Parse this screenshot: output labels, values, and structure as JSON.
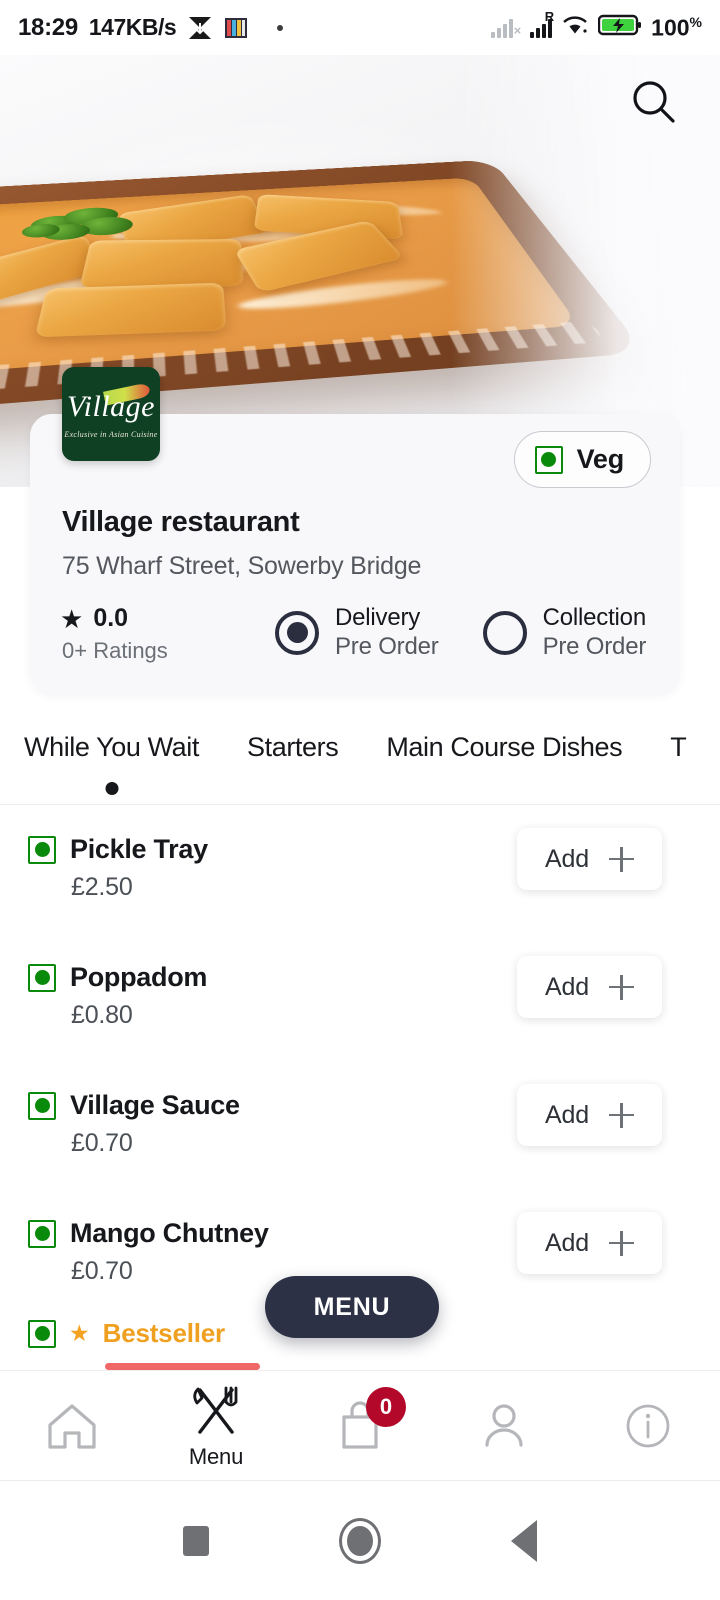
{
  "status_bar": {
    "time": "18:29",
    "network_speed": "147KB/s",
    "battery_percent": "100",
    "battery_percent_symbol": "%",
    "roaming_label": "R",
    "icons": [
      "download-arrow-icon",
      "colorful-app-icon",
      "notification-dot-icon",
      "signal-weak-icon",
      "signal-icon",
      "wifi-icon",
      "battery-charging-icon"
    ]
  },
  "header": {
    "search_icon": "search-icon",
    "hero_image_alt": "curry-dish-photo"
  },
  "restaurant": {
    "logo_name": "Village",
    "logo_tagline": "Exclusive in Asian Cuisine",
    "veg_badge": "Veg",
    "name": "Village restaurant",
    "address": "75 Wharf Street, Sowerby Bridge",
    "rating_value": "0.0",
    "rating_count": "0+ Ratings",
    "star_glyph": "★",
    "order_options": [
      {
        "label": "Delivery",
        "sub": "Pre Order",
        "selected": true
      },
      {
        "label": "Collection",
        "sub": "Pre Order",
        "selected": false
      }
    ]
  },
  "category_tabs": {
    "active_index": 0,
    "items": [
      {
        "label": "While You Wait"
      },
      {
        "label": "Starters"
      },
      {
        "label": "Main Course Dishes"
      },
      {
        "label": "T"
      }
    ]
  },
  "menu_items": [
    {
      "name": "Pickle Tray",
      "price": "£2.50",
      "veg": true,
      "add_label": "Add"
    },
    {
      "name": "Poppadom",
      "price": "£0.80",
      "veg": true,
      "add_label": "Add"
    },
    {
      "name": "Village Sauce",
      "price": "£0.70",
      "veg": true,
      "add_label": "Add"
    },
    {
      "name": "Mango Chutney",
      "price": "£0.70",
      "veg": true,
      "add_label": "Add"
    }
  ],
  "bestseller_row": {
    "tag_label": "Bestseller",
    "star_glyph": "★"
  },
  "menu_fab": {
    "label": "MENU"
  },
  "bottom_nav": {
    "items": [
      {
        "icon": "home-icon",
        "label": "",
        "active": false
      },
      {
        "icon": "cutlery-icon",
        "label": "Menu",
        "active": true
      },
      {
        "icon": "bag-icon",
        "label": "",
        "active": false,
        "badge": "0"
      },
      {
        "icon": "person-icon",
        "label": "",
        "active": false
      },
      {
        "icon": "info-icon",
        "label": "",
        "active": false
      }
    ]
  },
  "android_nav": {
    "items": [
      "recents-square-icon",
      "home-circle-icon",
      "back-triangle-icon"
    ]
  },
  "colors": {
    "veg_green": "#0a8a0a",
    "bestseller_orange": "#f0a020",
    "badge_red": "#b4082b",
    "fab_dark": "#2c3145",
    "scroll_indicator": "#f06767",
    "logo_green": "#104023"
  }
}
